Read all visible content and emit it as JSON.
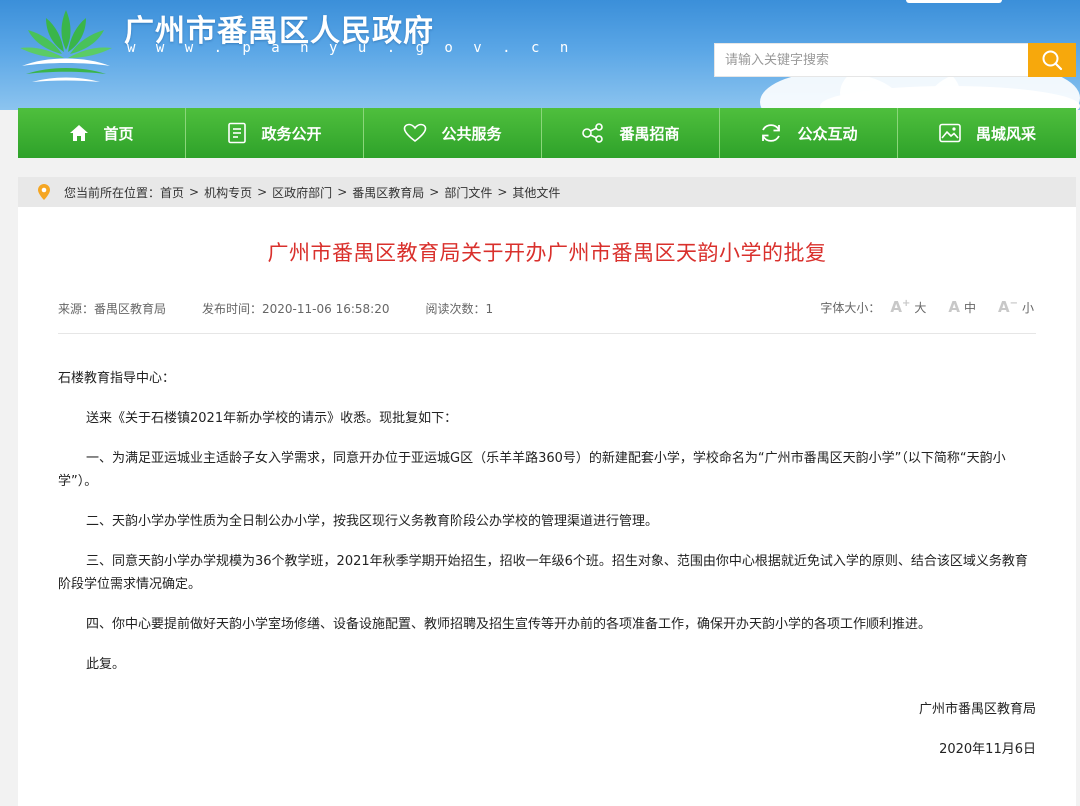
{
  "header": {
    "site_title": "广州市番禺区人民政府",
    "site_url": "w w w . p a n y u . g o v . c n",
    "search_placeholder": "请输入关键字搜索"
  },
  "nav": {
    "items": [
      {
        "label": "首页",
        "icon": "home-icon"
      },
      {
        "label": "政务公开",
        "icon": "document-list-icon"
      },
      {
        "label": "公共服务",
        "icon": "heart-icon"
      },
      {
        "label": "番禺招商",
        "icon": "network-icon"
      },
      {
        "label": "公众互动",
        "icon": "refresh-icon"
      },
      {
        "label": "禺城风采",
        "icon": "image-icon"
      }
    ]
  },
  "breadcrumb": {
    "prefix": "您当前所在位置：",
    "items": [
      "首页",
      "机构专页",
      "区政府部门",
      "番禺区教育局",
      "部门文件",
      "其他文件"
    ],
    "separator": ">"
  },
  "article": {
    "title": "广州市番禺区教育局关于开办广州市番禺区天韵小学的批复",
    "source": "来源：番禺区教育局",
    "publish_time": "发布时间：2020-11-06 16:58:20",
    "read_count": "阅读次数：1",
    "font_size_label": "字体大小：",
    "font_large": "大",
    "font_medium": "中",
    "font_small": "小",
    "paragraphs": [
      "石楼教育指导中心：",
      "送来《关于石楼镇2021年新办学校的请示》收悉。现批复如下：",
      "一、为满足亚运城业主适龄子女入学需求，同意开办位于亚运城G区（乐羊羊路360号）的新建配套小学，学校命名为“广州市番禺区天韵小学”（以下简称“天韵小学”）。",
      "二、天韵小学办学性质为全日制公办小学，按我区现行义务教育阶段公办学校的管理渠道进行管理。",
      "三、同意天韵小学办学规模为36个教学班，2021年秋季学期开始招生，招收一年级6个班。招生对象、范围由你中心根据就近免试入学的原则、结合该区域义务教育阶段学位需求情况确定。",
      "四、你中心要提前做好天韵小学室场修缮、设备设施配置、教师招聘及招生宣传等开办前的各项准备工作，确保开办天韵小学的各项工作顺利推进。",
      "此复。"
    ],
    "signature": "广州市番禺区教育局",
    "date": "2020年11月6日"
  },
  "colors": {
    "nav_green": "#2ea22a",
    "title_red": "#d9302c",
    "search_orange": "#f7a80c",
    "header_blue": "#3b8fd9"
  }
}
